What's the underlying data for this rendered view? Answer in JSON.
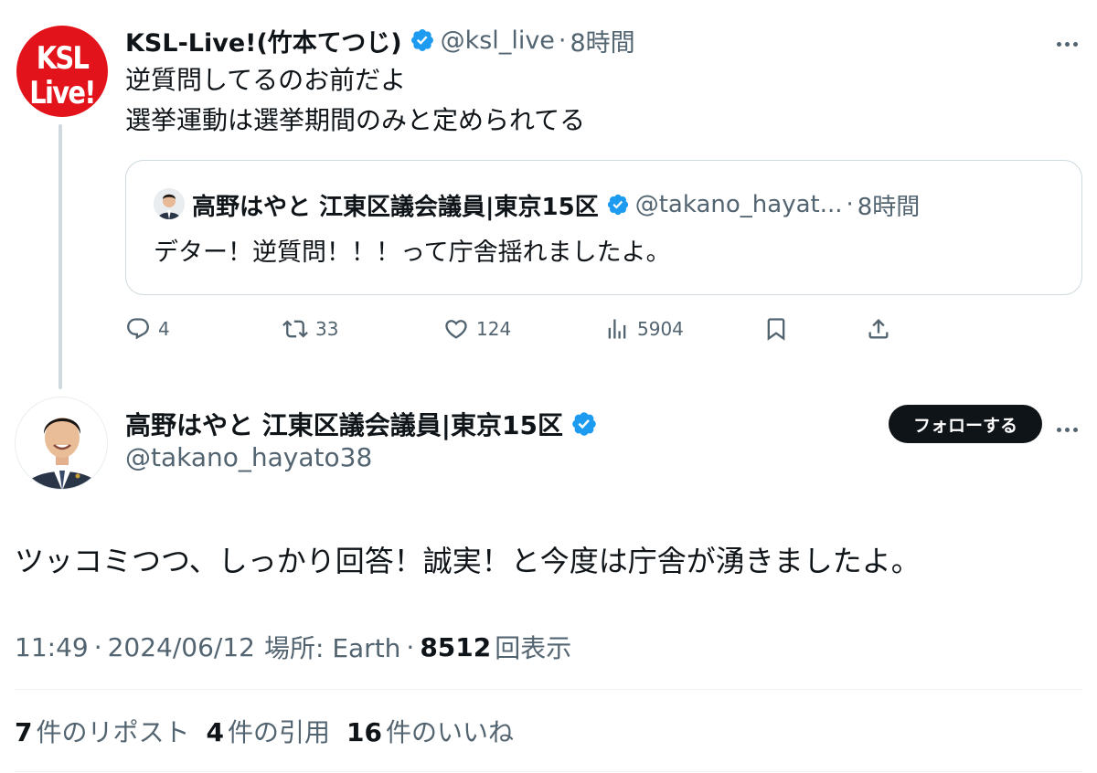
{
  "parent_tweet": {
    "avatar_text_line1": "KSL",
    "avatar_text_line2": "Live!",
    "display_name": "KSL-Live!(竹本てつじ)",
    "handle": "@ksl_live",
    "separator": "·",
    "time": "8時間",
    "text_line1": "逆質問してるのお前だよ",
    "text_line2": "選挙運動は選挙期間のみと定められてる",
    "quote": {
      "display_name": "高野はやと 江東区議会議員|東京15区",
      "handle": "@takano_hayat...",
      "separator": "·",
      "time": "8時間",
      "text": "デター！逆質問！！！って庁舎揺れましたよ。"
    },
    "actions": {
      "replies": "4",
      "reposts": "33",
      "likes": "124",
      "views": "5904"
    }
  },
  "main_tweet": {
    "display_name": "高野はやと 江東区議会議員|東京15区",
    "handle": "@takano_hayato38",
    "follow_label": "フォローする",
    "text": "ツッコミつつ、しっかり回答！誠実！と今度は庁舎が湧きましたよ。",
    "meta": {
      "time": "11:49",
      "sep1": "·",
      "date": "2024/06/12",
      "location": "場所: Earth",
      "sep2": "·",
      "views_count": "8512",
      "views_label": "回表示"
    },
    "stats": {
      "reposts_count": "7",
      "reposts_label": "件のリポスト",
      "quotes_count": "4",
      "quotes_label": "件の引用",
      "likes_count": "16",
      "likes_label": "件のいいね"
    }
  },
  "colors": {
    "verified": "#1d9bf0",
    "secondary_text": "#536471",
    "primary_text": "#0f1419",
    "ksl_red": "#e3131b"
  },
  "icons": [
    "verified-badge-icon",
    "more-options-icon",
    "reply-icon",
    "repost-icon",
    "like-icon",
    "views-icon",
    "bookmark-icon",
    "share-icon"
  ]
}
